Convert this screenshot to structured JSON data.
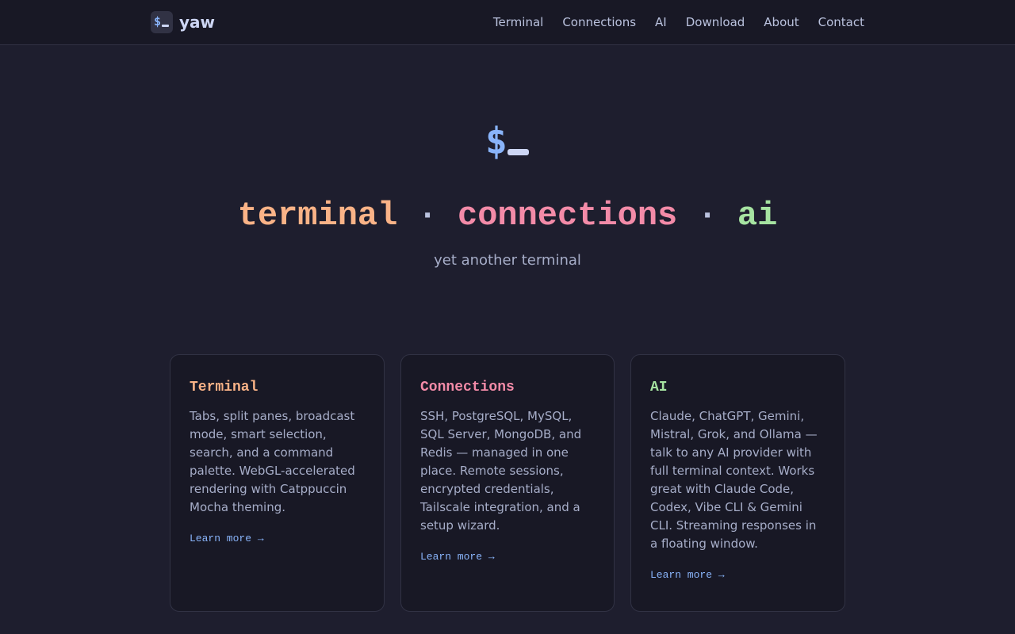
{
  "nav": {
    "brand_icon": "terminal-prompt-icon",
    "brand_name": "yaw",
    "links": [
      "Terminal",
      "Connections",
      "AI",
      "Download",
      "About",
      "Contact"
    ]
  },
  "hero": {
    "logo_icon": "terminal-prompt-icon",
    "tagline": {
      "terminal": "terminal",
      "separator": "·",
      "connections": "connections",
      "ai": "ai"
    },
    "subtitle": "yet another terminal"
  },
  "cards": [
    {
      "title": "Terminal",
      "color": "#fab387",
      "description": "Tabs, split panes, broadcast mode, smart selection, search, and a command palette. WebGL-accelerated rendering with Catppuccin Mocha theming.",
      "link": "Learn more →"
    },
    {
      "title": "Connections",
      "color": "#f38ba8",
      "description": "SSH, PostgreSQL, MySQL, SQL Server, MongoDB, and Redis — managed in one place. Remote sessions, encrypted credentials, Tailscale integration, and a setup wizard.",
      "link": "Learn more →"
    },
    {
      "title": "AI",
      "color": "#a6e3a1",
      "description": "Claude, ChatGPT, Gemini, Mistral, Grok, and Ollama — talk to any AI provider with full terminal context. Works great with Claude Code, Codex, Vibe CLI & Gemini CLI. Streaming responses in a floating window.",
      "link": "Learn more →"
    }
  ],
  "theme": {
    "background": "#1e1e2e",
    "nav_background": "#181825",
    "accent_blue": "#89b4fa",
    "accent_peach": "#fab387",
    "accent_pink": "#f38ba8",
    "accent_green": "#a6e3a1"
  }
}
